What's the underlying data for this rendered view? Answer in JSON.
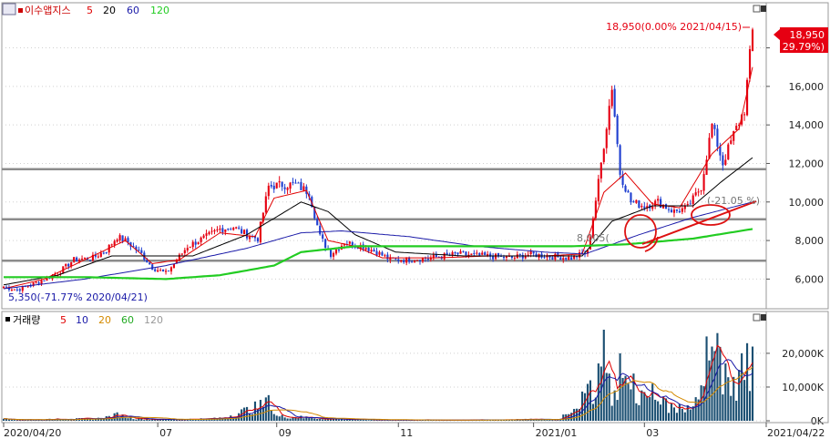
{
  "chart_data": [
    {
      "type": "candlestick",
      "name": "이수앱지스",
      "x_range": [
        "2020/04/20",
        "2021/04/22"
      ],
      "ylim": [
        4600,
        20200
      ],
      "y_ticks": [
        6000,
        8000,
        10000,
        12000,
        14000,
        16000,
        18000
      ],
      "y_tick_labels": [
        "6,000",
        "8,000",
        "10,000",
        "12,000",
        "14,000",
        "16,000",
        "18,000"
      ],
      "legend": [
        {
          "label": "이수앱지스",
          "color": "#cc0000"
        },
        {
          "label": "5",
          "color": "#e00000"
        },
        {
          "label": "20",
          "color": "#000000"
        },
        {
          "label": "60",
          "color": "#1a1aa8"
        },
        {
          "label": "120",
          "color": "#22cc22"
        }
      ],
      "current_price": {
        "label": "18,950",
        "change": "( 29.79%)",
        "color": "#e60012"
      },
      "annotations": {
        "high": "18,950(0.00% 2021/04/15)",
        "low": "5,350(-71.77% 2020/04/21)",
        "mid_left": "8,005(",
        "mid_right": "(-21.05 %)"
      },
      "horizontal_lines": [
        11700,
        9100,
        6950
      ],
      "colors": {
        "up": "#e60012",
        "down": "#1f3fd0",
        "ma5": "#e00000",
        "ma20": "#000000",
        "ma60": "#1a1aa8",
        "ma120": "#22cc22",
        "hline": "#8c8c8c",
        "markup": "#dd1111"
      },
      "price_path": [
        [
          0,
          5600
        ],
        [
          5,
          5450
        ],
        [
          12,
          5800
        ],
        [
          20,
          6300
        ],
        [
          26,
          7000
        ],
        [
          33,
          7100
        ],
        [
          38,
          7500
        ],
        [
          42,
          8200
        ],
        [
          46,
          7900
        ],
        [
          51,
          7300
        ],
        [
          55,
          6600
        ],
        [
          60,
          6300
        ],
        [
          63,
          6800
        ],
        [
          68,
          7700
        ],
        [
          75,
          8200
        ],
        [
          80,
          8600
        ],
        [
          85,
          8700
        ],
        [
          90,
          8300
        ],
        [
          94,
          8100
        ],
        [
          98,
          10800
        ],
        [
          103,
          10900
        ],
        [
          108,
          10900
        ],
        [
          113,
          10500
        ],
        [
          117,
          8200
        ],
        [
          121,
          7300
        ],
        [
          126,
          7900
        ],
        [
          133,
          7700
        ],
        [
          138,
          7400
        ],
        [
          143,
          7000
        ],
        [
          148,
          7000
        ],
        [
          158,
          7100
        ],
        [
          168,
          7300
        ],
        [
          178,
          7200
        ],
        [
          188,
          7100
        ],
        [
          195,
          7300
        ],
        [
          200,
          7200
        ],
        [
          210,
          7100
        ],
        [
          216,
          7400
        ],
        [
          220,
          11000
        ],
        [
          225,
          16000
        ],
        [
          228,
          11500
        ],
        [
          232,
          10000
        ],
        [
          237,
          9800
        ],
        [
          242,
          10000
        ],
        [
          248,
          9500
        ],
        [
          253,
          9700
        ],
        [
          258,
          10800
        ],
        [
          262,
          14000
        ],
        [
          266,
          12000
        ],
        [
          270,
          13500
        ],
        [
          274,
          14800
        ],
        [
          277,
          18950
        ]
      ],
      "ma_series": [
        {
          "label": "5",
          "values": [
            [
              0,
              5500
            ],
            [
              15,
              6000
            ],
            [
              30,
              7000
            ],
            [
              45,
              8000
            ],
            [
              55,
              6800
            ],
            [
              65,
              7000
            ],
            [
              80,
              8400
            ],
            [
              93,
              8200
            ],
            [
              100,
              10200
            ],
            [
              112,
              10600
            ],
            [
              120,
              8000
            ],
            [
              130,
              7700
            ],
            [
              140,
              7100
            ],
            [
              160,
              7100
            ],
            [
              180,
              7200
            ],
            [
              200,
              7200
            ],
            [
              214,
              7300
            ],
            [
              222,
              10500
            ],
            [
              230,
              11500
            ],
            [
              240,
              9900
            ],
            [
              250,
              9700
            ],
            [
              262,
              12500
            ],
            [
              272,
              13800
            ],
            [
              277,
              17000
            ]
          ]
        },
        {
          "label": "20",
          "values": [
            [
              0,
              5700
            ],
            [
              20,
              6200
            ],
            [
              40,
              7200
            ],
            [
              55,
              7200
            ],
            [
              70,
              7200
            ],
            [
              90,
              8300
            ],
            [
              110,
              10000
            ],
            [
              120,
              9500
            ],
            [
              130,
              8300
            ],
            [
              145,
              7400
            ],
            [
              170,
              7200
            ],
            [
              200,
              7200
            ],
            [
              214,
              7200
            ],
            [
              225,
              9000
            ],
            [
              240,
              9800
            ],
            [
              255,
              9800
            ],
            [
              265,
              11000
            ],
            [
              277,
              12300
            ]
          ]
        },
        {
          "label": "60",
          "values": [
            [
              0,
              5500
            ],
            [
              30,
              6000
            ],
            [
              60,
              6700
            ],
            [
              90,
              7600
            ],
            [
              110,
              8400
            ],
            [
              125,
              8500
            ],
            [
              150,
              8200
            ],
            [
              175,
              7700
            ],
            [
              200,
              7400
            ],
            [
              215,
              7300
            ],
            [
              235,
              8300
            ],
            [
              255,
              9200
            ],
            [
              277,
              10000
            ]
          ]
        },
        {
          "label": "120",
          "values": [
            [
              0,
              6100
            ],
            [
              30,
              6100
            ],
            [
              60,
              6000
            ],
            [
              80,
              6200
            ],
            [
              100,
              6700
            ],
            [
              110,
              7400
            ],
            [
              130,
              7700
            ],
            [
              160,
              7700
            ],
            [
              190,
              7700
            ],
            [
              210,
              7700
            ],
            [
              230,
              7800
            ],
            [
              255,
              8100
            ],
            [
              277,
              8600
            ]
          ]
        }
      ]
    },
    {
      "type": "bar",
      "name": "거래량",
      "ylim": [
        0,
        27000
      ],
      "y_ticks": [
        0,
        10000,
        20000
      ],
      "y_tick_labels": [
        "0K",
        "10,000K",
        "20,000K"
      ],
      "legend": [
        {
          "label": "거래량",
          "color": "#000000"
        },
        {
          "label": "5",
          "color": "#e00000"
        },
        {
          "label": "10",
          "color": "#1a1aa8"
        },
        {
          "label": "20",
          "color": "#d48a00"
        },
        {
          "label": "60",
          "color": "#22aa22"
        },
        {
          "label": "120",
          "color": "#999999"
        }
      ],
      "x_ticks": [
        "2020/04/20",
        "07",
        "09",
        "11",
        "2021/01",
        "03",
        "2021/04/22"
      ],
      "volume_peaks": [
        [
          0,
          600
        ],
        [
          10,
          400
        ],
        [
          20,
          700
        ],
        [
          35,
          900
        ],
        [
          42,
          2500
        ],
        [
          50,
          800
        ],
        [
          60,
          500
        ],
        [
          80,
          1000
        ],
        [
          98,
          7600
        ],
        [
          100,
          2000
        ],
        [
          110,
          1500
        ],
        [
          120,
          800
        ],
        [
          140,
          400
        ],
        [
          170,
          300
        ],
        [
          195,
          600
        ],
        [
          205,
          500
        ],
        [
          217,
          12000
        ],
        [
          220,
          17000
        ],
        [
          222,
          27000
        ],
        [
          224,
          14000
        ],
        [
          226,
          9000
        ],
        [
          228,
          20000
        ],
        [
          231,
          11000
        ],
        [
          233,
          14000
        ],
        [
          236,
          9000
        ],
        [
          240,
          11000
        ],
        [
          244,
          7000
        ],
        [
          250,
          5000
        ],
        [
          256,
          7000
        ],
        [
          260,
          25000
        ],
        [
          262,
          22000
        ],
        [
          264,
          26000
        ],
        [
          267,
          17000
        ],
        [
          270,
          13000
        ],
        [
          273,
          20000
        ],
        [
          275,
          23000
        ],
        [
          277,
          22000
        ]
      ]
    }
  ]
}
